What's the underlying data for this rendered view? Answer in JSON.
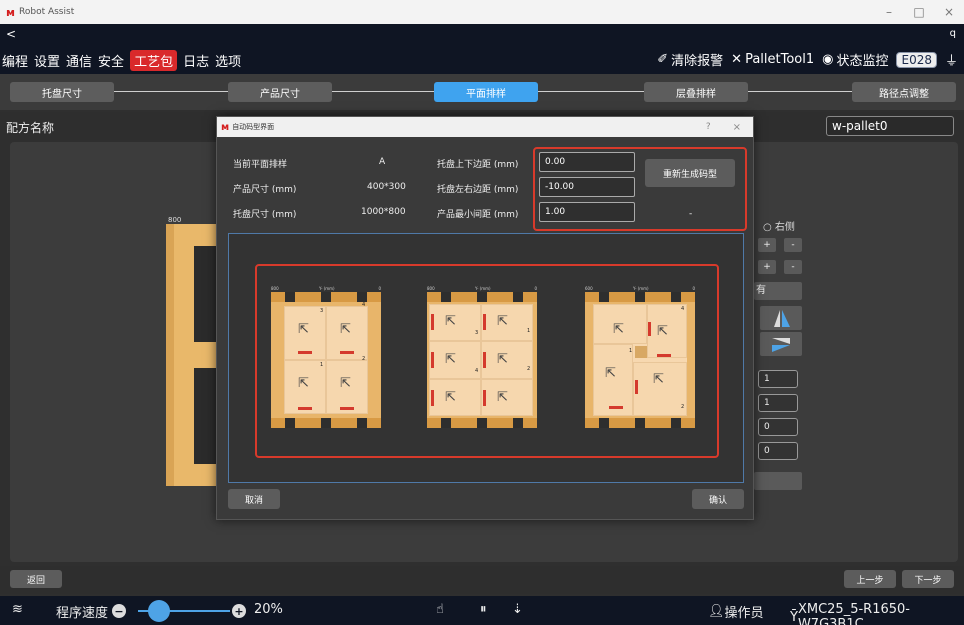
{
  "window": {
    "title": "Robot Assist",
    "minimize": "–",
    "maximize": "□",
    "close": "×"
  },
  "topbar": {
    "back": "<",
    "search": "q",
    "menu": [
      "编程",
      "设置",
      "通信",
      "安全",
      "工艺包",
      "日志",
      "选项"
    ],
    "active_menu": "工艺包",
    "clear_alarm": "清除报警",
    "tool": "PalletTool1",
    "status_monitor": "状态监控",
    "error_code": "E028"
  },
  "steps": [
    "托盘尺寸",
    "产品尺寸",
    "平面排样",
    "层叠排样",
    "路径点调整"
  ],
  "active_step": "平面排样",
  "recipe": {
    "label": "配方名称",
    "value": "w-pallet0"
  },
  "background": {
    "pallet_label": "800",
    "radio_right": "右侧",
    "plus": "+",
    "minus": "-",
    "yes": "有",
    "fields": [
      "1",
      "1",
      "0",
      "0"
    ]
  },
  "dialog": {
    "title": "自动码型界面",
    "help": "?",
    "close": "×",
    "info": [
      {
        "label": "当前平面排样",
        "value": "A"
      },
      {
        "label": "产品尺寸 (mm)",
        "value": "400*300"
      },
      {
        "label": "托盘尺寸 (mm)",
        "value": "1000*800"
      }
    ],
    "margins": [
      {
        "label": "托盘上下边距 (mm)",
        "value": "0.00"
      },
      {
        "label": "托盘左右边距 (mm)",
        "value": "-10.00"
      },
      {
        "label": "产品最小间距 (mm)",
        "value": "1.00"
      }
    ],
    "regen_button": "重新生成码型",
    "dash": "-",
    "cancel": "取消",
    "confirm": "确认",
    "patterns": [
      {
        "header_left": "800",
        "header_mid": "Y- (mm)",
        "header_right": "0",
        "nums": [
          "3",
          "4",
          "1",
          "2"
        ]
      },
      {
        "header_left": "800",
        "header_mid": "Y- (mm)",
        "header_right": "0",
        "nums": [
          "1",
          "2",
          "3",
          "4"
        ]
      },
      {
        "header_left": "600",
        "header_mid": "Y- (mm)",
        "header_right": "0",
        "nums": [
          "4",
          "1",
          "2"
        ]
      }
    ]
  },
  "bottom": {
    "back": "返回",
    "prev": "上一步",
    "next": "下一步"
  },
  "status": {
    "speed_label": "程序速度",
    "speed_value": "20%",
    "user": "操作员",
    "controller": "XMC25_5-R1650-W7G3B1C"
  },
  "colors": {
    "accent_blue": "#3fa3ef",
    "active_red": "#d9292b",
    "highlight_red": "#d83a2b",
    "pallet_wood": "#e8b56a"
  }
}
